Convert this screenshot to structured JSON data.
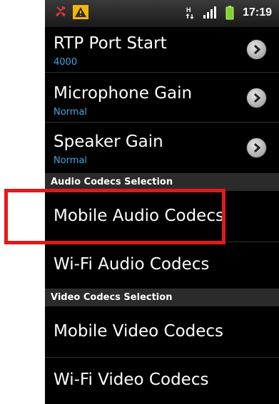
{
  "status_bar": {
    "time": "17:19",
    "network_type": "H",
    "icons": [
      "missed-call-icon",
      "warning-icon",
      "h-network-icon",
      "signal-icon",
      "battery-icon"
    ]
  },
  "settings": {
    "rtp_port": {
      "title": "RTP Port Start",
      "summary": "4000"
    },
    "mic_gain": {
      "title": "Microphone Gain",
      "summary": "Normal"
    },
    "speaker_gain": {
      "title": "Speaker Gain",
      "summary": "Normal"
    }
  },
  "audio_section": {
    "header": "Audio Codecs Selection",
    "mobile": "Mobile Audio Codecs",
    "wifi": "Wi-Fi Audio Codecs"
  },
  "video_section": {
    "header": "Video Codecs Selection",
    "mobile": "Mobile Video Codecs",
    "wifi": "Wi-Fi Video Codecs"
  },
  "colors": {
    "summary_blue": "#3fa7e6",
    "highlight_red": "#e31919",
    "header_bg": "#2b2b2b"
  }
}
